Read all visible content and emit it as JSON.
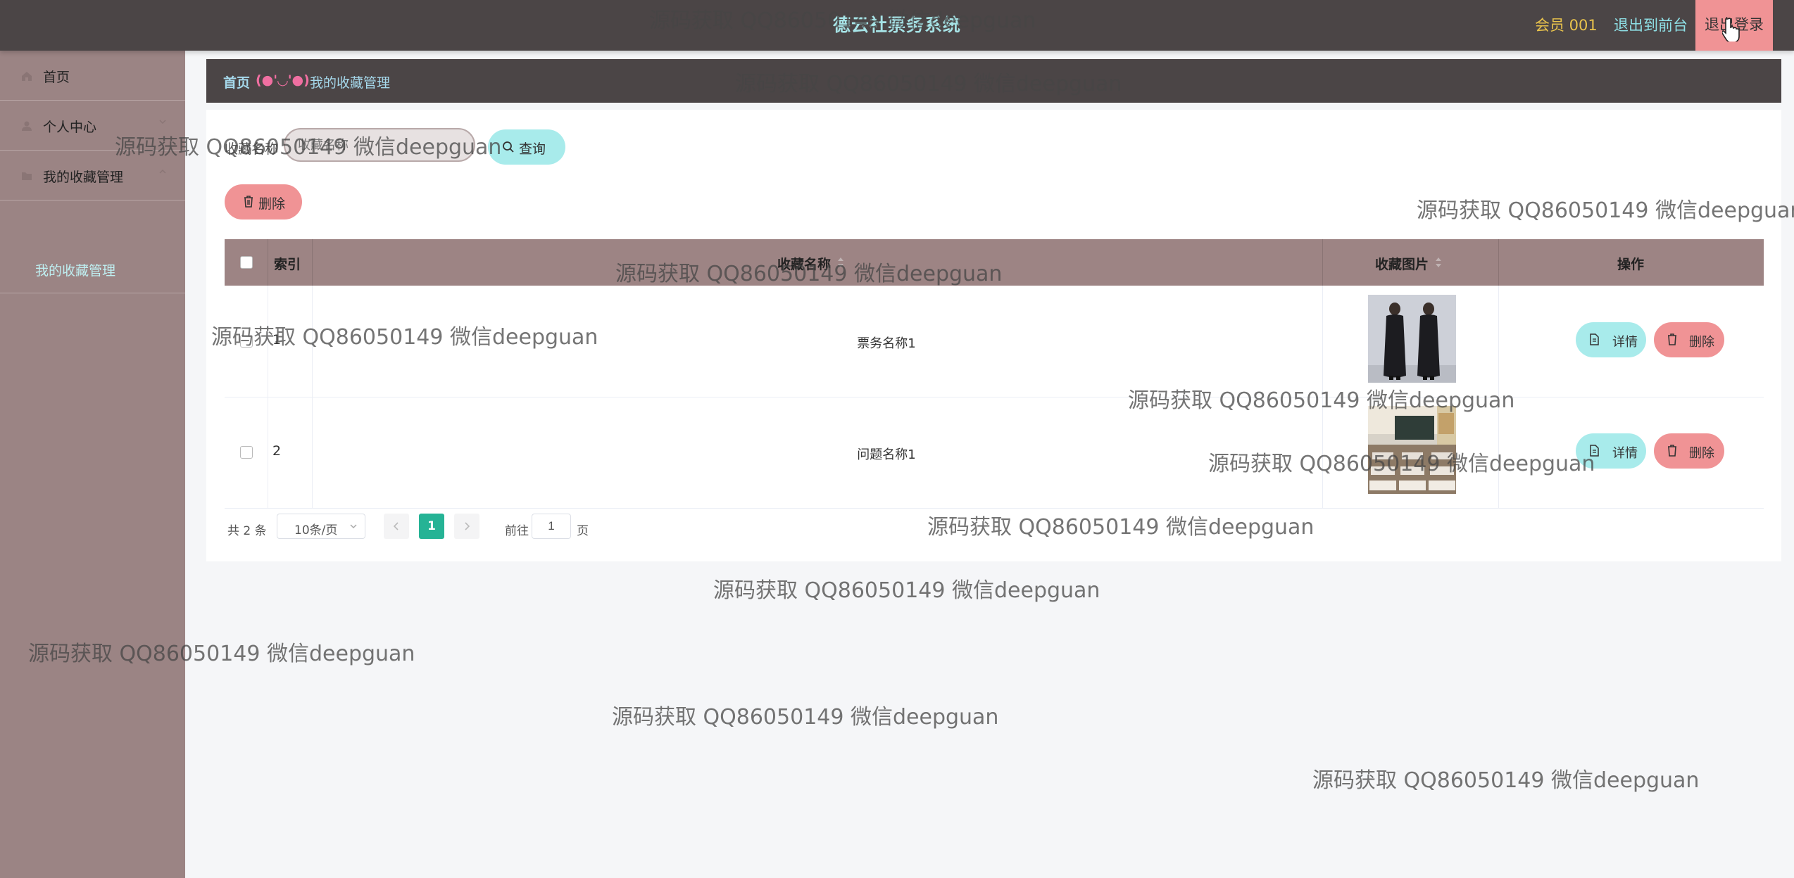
{
  "header": {
    "title": "德云社票务系统",
    "member_label": "会员 001",
    "to_front_label": "退出到前台",
    "logout_label": "退出登录"
  },
  "sidebar": {
    "items": [
      {
        "label": "首页"
      },
      {
        "label": "个人中心"
      },
      {
        "label": "我的收藏管理"
      }
    ],
    "sub_item": "我的收藏管理"
  },
  "breadcrumb": {
    "home": "首页",
    "face": "(●'◡'●)",
    "current": "我的收藏管理"
  },
  "search": {
    "label": "收藏名称",
    "placeholder": "收藏名称",
    "query_label": "查询"
  },
  "toolbar": {
    "delete_label": "删除"
  },
  "table": {
    "columns": [
      "索引",
      "收藏名称",
      "收藏图片",
      "操作"
    ],
    "rows": [
      {
        "index": "1",
        "name": "票务名称1",
        "image": "two-performers-in-robes-photo"
      },
      {
        "index": "2",
        "name": "问题名称1",
        "image": "classroom-photo"
      }
    ],
    "detail_label": "详情",
    "delete_label": "删除"
  },
  "pagination": {
    "total": "共 2 条",
    "page_size": "10条/页",
    "current_page": "1",
    "goto_label": "前往",
    "goto_value": "1",
    "page_unit": "页"
  },
  "watermark": "源码获取 QQ86050149 微信deepguan",
  "colors": {
    "header_bg": "#4b4546",
    "sidebar_bg": "#9b8484",
    "table_header_bg": "#9d8484",
    "cyan_button": "#a8ebeb",
    "pink_button": "#f09395",
    "pager_active": "#25b395"
  }
}
